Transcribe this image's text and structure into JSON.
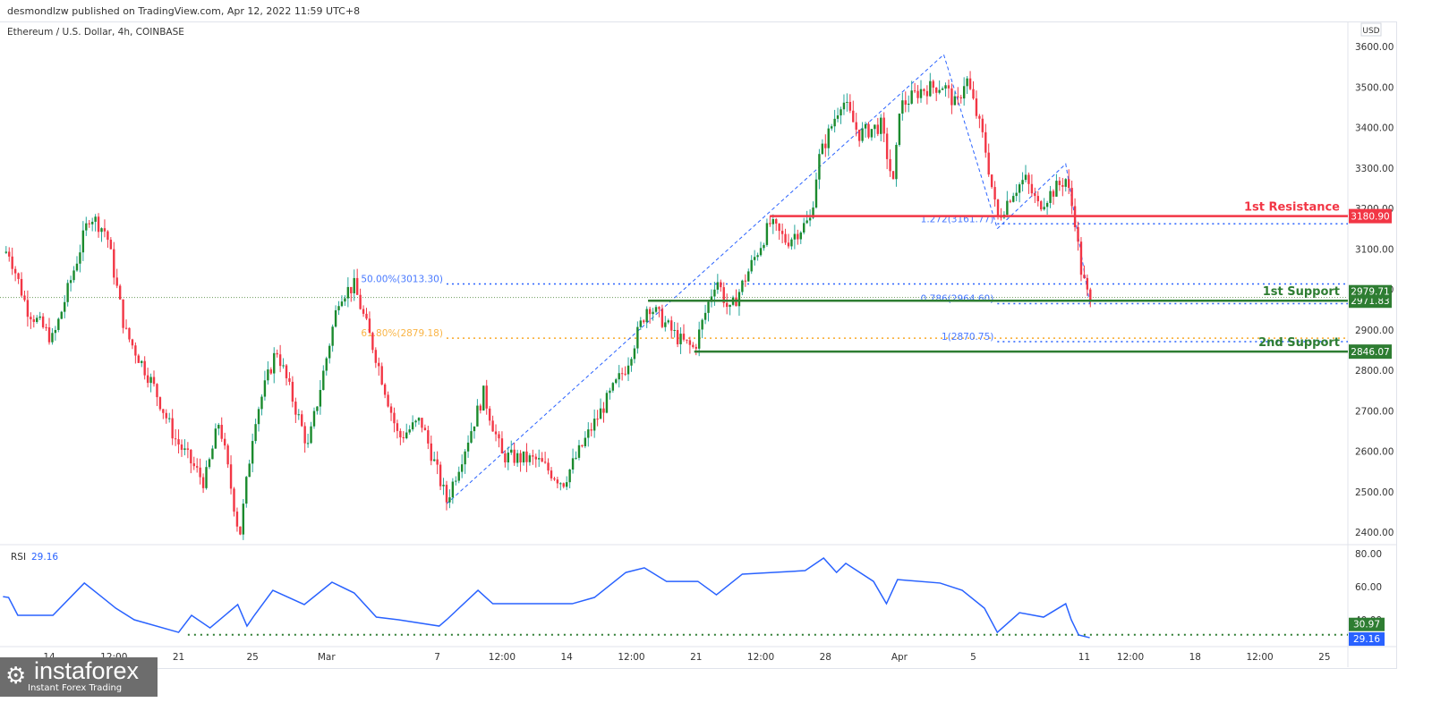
{
  "header": {
    "published": "desmondlzw published on TradingView.com, Apr 12, 2022 11:59 UTC+8",
    "symbol": "Ethereum / U.S. Dollar, 4h, COINBASE",
    "currency": "USD"
  },
  "logo": {
    "name": "instaforex",
    "tagline": "Instant Forex Trading"
  },
  "colors": {
    "up": "#26a69a",
    "up_body": "#1b8a2d",
    "down": "#f23645",
    "resistance": "#f23645",
    "support": "#2e7d32",
    "fib_blue": "#2962ff",
    "fib_orange": "#f9a825",
    "rsi": "#2962ff"
  },
  "chart_data": [
    {
      "type": "candlestick",
      "title": "Ethereum / U.S. Dollar, 4h, COINBASE",
      "ylabel": "USD",
      "ylim": [
        2360,
        3660
      ],
      "yticks": [
        "3600.00",
        "3500.00",
        "3400.00",
        "3300.00",
        "3200.00",
        "3100.00",
        "3000.00",
        "2900.00",
        "2800.00",
        "2700.00",
        "2600.00",
        "2500.00",
        "2400.00"
      ],
      "ytick_values": [
        3600,
        3500,
        3400,
        3300,
        3200,
        3100,
        3000,
        2900,
        2800,
        2700,
        2600,
        2500,
        2400
      ],
      "xticks": [
        {
          "d": 4,
          "label": "14"
        },
        {
          "d": 7.5,
          "label": "12:00"
        },
        {
          "d": 11,
          "label": "21"
        },
        {
          "d": 15,
          "label": "25"
        },
        {
          "d": 19,
          "label": "Mar"
        },
        {
          "d": 25,
          "label": "7"
        },
        {
          "d": 28.5,
          "label": "12:00"
        },
        {
          "d": 32,
          "label": "14"
        },
        {
          "d": 35.5,
          "label": "12:00"
        },
        {
          "d": 39,
          "label": "21"
        },
        {
          "d": 42.5,
          "label": "12:00"
        },
        {
          "d": 46,
          "label": "28"
        },
        {
          "d": 50,
          "label": "Apr"
        },
        {
          "d": 54,
          "label": "5"
        },
        {
          "d": 60,
          "label": "11"
        },
        {
          "d": 62.5,
          "label": "12:00"
        },
        {
          "d": 66,
          "label": "18"
        },
        {
          "d": 69.5,
          "label": "12:00"
        },
        {
          "d": 73,
          "label": "25"
        }
      ],
      "x_unit": "days since Feb 10, 2022",
      "close_path": [
        [
          1.5,
          3090
        ],
        [
          1.8,
          3096
        ],
        [
          2.8,
          2952
        ],
        [
          4.2,
          2875
        ],
        [
          5.5,
          3074
        ],
        [
          6.2,
          3185
        ],
        [
          7.1,
          3140
        ],
        [
          8.1,
          2897
        ],
        [
          9.6,
          2765
        ],
        [
          10.8,
          2632
        ],
        [
          12.4,
          2522
        ],
        [
          13.2,
          2676
        ],
        [
          14.3,
          2389
        ],
        [
          15.1,
          2676
        ],
        [
          16.3,
          2853
        ],
        [
          18.0,
          2610
        ],
        [
          19.7,
          2986
        ],
        [
          20.5,
          3008
        ],
        [
          21.7,
          2831
        ],
        [
          22.9,
          2632
        ],
        [
          24.1,
          2676
        ],
        [
          25.5,
          2477
        ],
        [
          27.5,
          2742
        ],
        [
          28.5,
          2588
        ],
        [
          30.4,
          2577
        ],
        [
          31.8,
          2522
        ],
        [
          33.3,
          2654
        ],
        [
          35.2,
          2809
        ],
        [
          36.4,
          2964
        ],
        [
          38.1,
          2875
        ],
        [
          38.9,
          2853
        ],
        [
          40.1,
          3030
        ],
        [
          40.8,
          2941
        ],
        [
          43.0,
          3162
        ],
        [
          43.9,
          3118
        ],
        [
          45.2,
          3173
        ],
        [
          45.6,
          3317
        ],
        [
          46.9,
          3472
        ],
        [
          47.8,
          3383
        ],
        [
          49.0,
          3405
        ],
        [
          49.7,
          3251
        ],
        [
          50.0,
          3450
        ],
        [
          51.2,
          3494
        ],
        [
          52.4,
          3505
        ],
        [
          53.1,
          3450
        ],
        [
          53.6,
          3527
        ],
        [
          54.6,
          3361
        ],
        [
          55.3,
          3173
        ],
        [
          56.1,
          3240
        ],
        [
          56.8,
          3273
        ],
        [
          57.5,
          3207
        ],
        [
          59.0,
          3273
        ],
        [
          59.5,
          3173
        ],
        [
          59.8,
          3052
        ],
        [
          60.3,
          2964
        ]
      ],
      "levels": [
        {
          "name": "1st Resistance",
          "value": 3180.9,
          "label": "3180.90",
          "from_d": 43.0,
          "color": "resistance"
        },
        {
          "name": "1st Support",
          "value": 2971.83,
          "label": "2971.83",
          "from_d": 36.4,
          "color": "support"
        },
        {
          "name": "2nd Support",
          "value": 2846.07,
          "label": "2846.07",
          "from_d": 38.9,
          "color": "support"
        }
      ],
      "last_price": {
        "value": 2979.71,
        "label": "2979.71"
      },
      "fib": [
        {
          "label": "50.00%(3013.30)",
          "value": 3013.3,
          "from_d": 25.5,
          "color": "fib_blue"
        },
        {
          "label": "61.80%(2879.18)",
          "value": 2879.18,
          "from_d": 25.5,
          "color": "fib_orange"
        },
        {
          "label": "1.272(3161.77)",
          "value": 3161.77,
          "from_d": 55.3,
          "color": "fib_blue"
        },
        {
          "label": "0.786(2964.60)",
          "value": 2964.6,
          "from_d": 55.3,
          "color": "fib_blue"
        },
        {
          "label": "1(2870.75)",
          "value": 2870.75,
          "from_d": 55.3,
          "color": "fib_blue"
        }
      ],
      "trendlines": [
        [
          [
            25.5,
            2470
          ],
          [
            52.4,
            3580
          ],
          [
            55.3,
            3150
          ]
        ],
        [
          [
            55.3,
            3150
          ],
          [
            59.0,
            3310
          ],
          [
            60.3,
            2965
          ]
        ]
      ]
    },
    {
      "type": "line",
      "title": "RSI",
      "value_label": "29.16",
      "ylim": [
        25,
        85
      ],
      "yticks": [
        "80.00",
        "60.00",
        "40.00"
      ],
      "ytick_values": [
        80,
        60,
        40
      ],
      "markers": [
        {
          "value": 30.97,
          "label": "30.97"
        },
        {
          "value": 29.16,
          "label": "29.16"
        }
      ],
      "points": [
        [
          1.5,
          54
        ],
        [
          1.8,
          53.5
        ],
        [
          2.3,
          42.7
        ],
        [
          4.2,
          42.7
        ],
        [
          5.9,
          62.2
        ],
        [
          6.7,
          55.1
        ],
        [
          7.6,
          47
        ],
        [
          8.6,
          40
        ],
        [
          11.0,
          32.4
        ],
        [
          11.7,
          42.7
        ],
        [
          12.7,
          35.1
        ],
        [
          14.2,
          49.2
        ],
        [
          14.7,
          36.2
        ],
        [
          15.1,
          42.7
        ],
        [
          16.1,
          57.8
        ],
        [
          17.8,
          49.2
        ],
        [
          19.3,
          62.7
        ],
        [
          20.5,
          56.2
        ],
        [
          21.7,
          41.6
        ],
        [
          22.9,
          40
        ],
        [
          25.1,
          36.2
        ],
        [
          25.5,
          40
        ],
        [
          27.2,
          57.8
        ],
        [
          28.0,
          49.7
        ],
        [
          32.3,
          49.7
        ],
        [
          33.5,
          53.5
        ],
        [
          35.2,
          68.6
        ],
        [
          36.2,
          71.4
        ],
        [
          37.4,
          63.2
        ],
        [
          39.1,
          63.2
        ],
        [
          40.1,
          55.1
        ],
        [
          41.5,
          67.6
        ],
        [
          44.9,
          69.7
        ],
        [
          45.9,
          77.3
        ],
        [
          46.6,
          68.6
        ],
        [
          47.1,
          74.1
        ],
        [
          48.6,
          63.2
        ],
        [
          49.3,
          49.7
        ],
        [
          49.9,
          64.3
        ],
        [
          52.2,
          62.2
        ],
        [
          53.4,
          57.8
        ],
        [
          54.6,
          47
        ],
        [
          55.3,
          32.4
        ],
        [
          56.5,
          44.3
        ],
        [
          57.8,
          41.6
        ],
        [
          59.0,
          49.7
        ],
        [
          59.3,
          40
        ],
        [
          59.7,
          30.8
        ],
        [
          60.3,
          29.16
        ]
      ]
    }
  ]
}
